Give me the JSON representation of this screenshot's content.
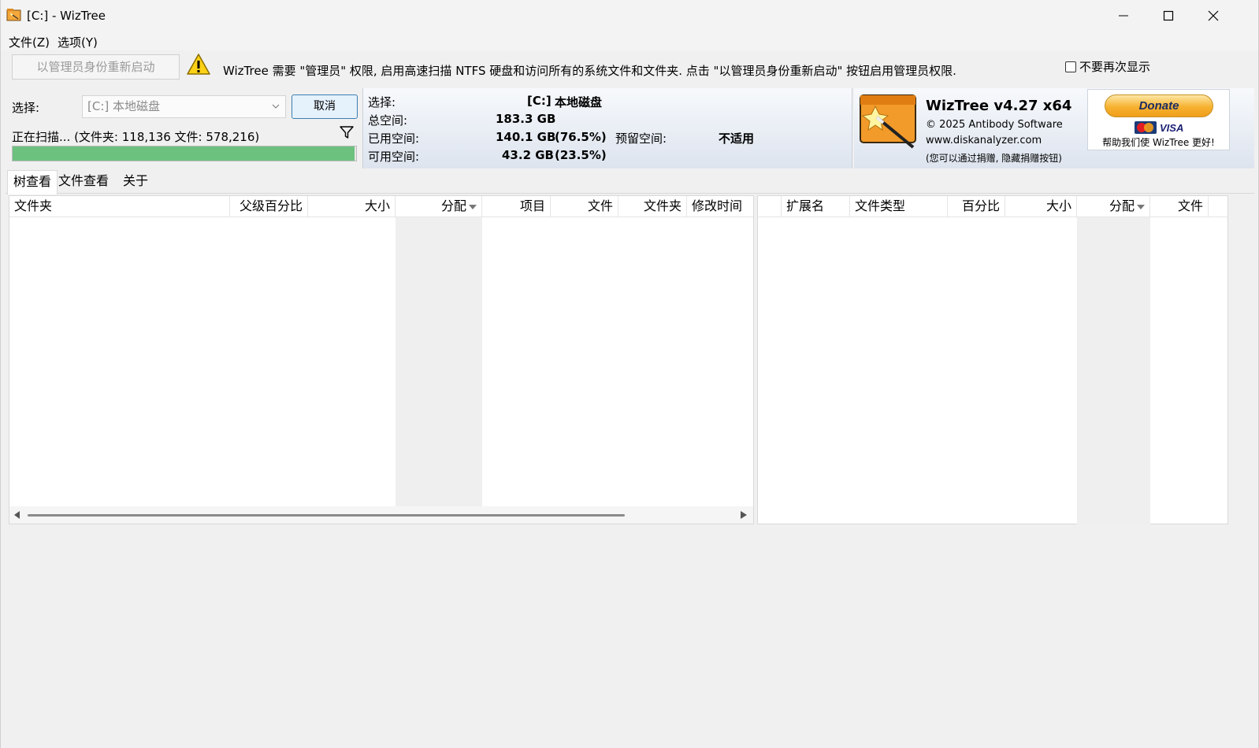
{
  "window": {
    "title": "[C:]  - WizTree"
  },
  "menu": {
    "items": [
      "文件(Z)",
      "选项(Y)"
    ]
  },
  "admin_bar": {
    "restart_button": "以管理员身份重新启动",
    "message": "WizTree 需要 \"管理员\" 权限, 启用高速扫描 NTFS 硬盘和访问所有的系统文件和文件夹. 点击 \"以管理员身份重新启动\" 按钮启用管理员权限.",
    "dont_show_label": "不要再次显示",
    "dont_show_checked": false
  },
  "scan": {
    "select_label": "选择:",
    "drive": "[C:] 本地磁盘",
    "cancel_label": "取消",
    "status": "正在扫描... (文件夹: 118,136  文件: 578,216)",
    "progress": 0.995
  },
  "drive_info": {
    "select_label": "选择:",
    "drive_letter": "[C:]",
    "drive_name": "本地磁盘",
    "total_label": "总空间:",
    "total_value": "183.3 GB",
    "used_label": "已用空间:",
    "used_value": "140.1 GB",
    "used_percent": "(76.5%)",
    "reserved_label": "预留空间:",
    "reserved_value": "不适用",
    "free_label": "可用空间:",
    "free_value": "43.2 GB",
    "free_percent": "(23.5%)"
  },
  "about": {
    "title": "WizTree v4.27 x64",
    "copyright": "© 2025 Antibody Software",
    "website": "www.diskanalyzer.com",
    "note": "(您可以通过捐赠, 隐藏捐赠按钮)",
    "donate_label": "Donate",
    "visa_label": "VISA",
    "donate_text": "帮助我们使 WizTree 更好!"
  },
  "tabs": [
    "树查看",
    "文件查看",
    "关于"
  ],
  "tree_columns": [
    "文件夹",
    "父级百分比",
    "大小",
    "分配",
    "项目",
    "文件",
    "文件夹",
    "修改时间"
  ],
  "ext_columns": [
    "扩展名",
    "文件类型",
    "百分比",
    "大小",
    "分配",
    "文件"
  ]
}
